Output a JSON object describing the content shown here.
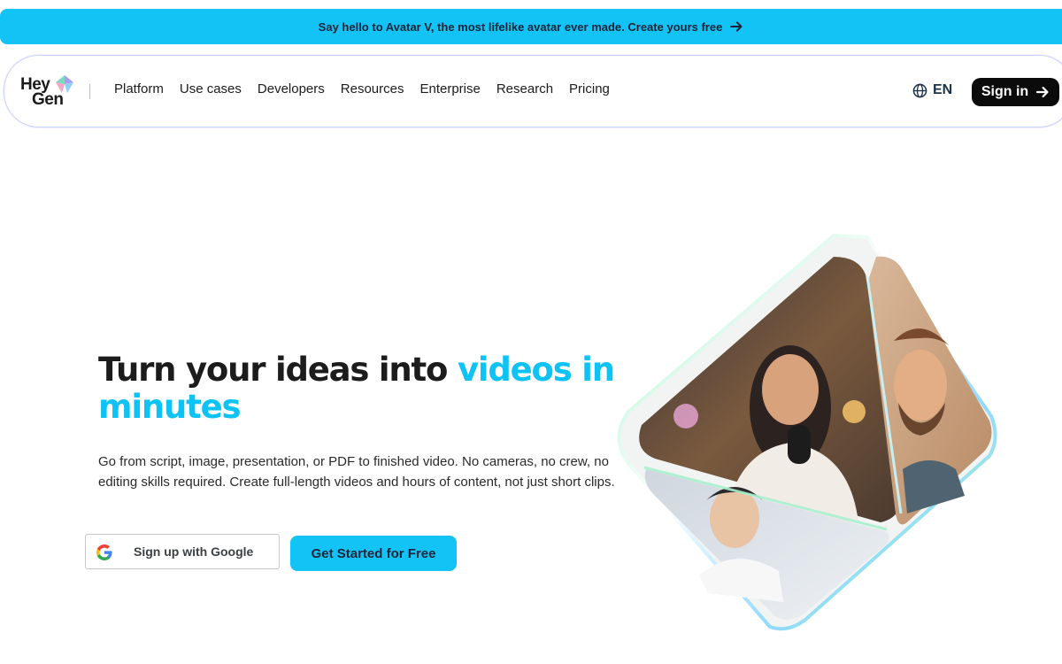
{
  "announcement": {
    "text": "Say hello to Avatar V, the most lifelike avatar ever made. Create yours free",
    "icon": "arrow-right-icon"
  },
  "header": {
    "logo_line1": "Hey",
    "logo_line2": "Gen",
    "nav": [
      {
        "label": "Platform"
      },
      {
        "label": "Use cases"
      },
      {
        "label": "Developers"
      },
      {
        "label": "Resources"
      },
      {
        "label": "Enterprise"
      },
      {
        "label": "Research"
      },
      {
        "label": "Pricing"
      }
    ],
    "language": {
      "label": "EN",
      "icon": "globe-icon"
    },
    "signin": {
      "label": "Sign in",
      "icon": "arrow-right-icon"
    }
  },
  "hero": {
    "title_plain": "Turn your ideas into ",
    "title_accent_1": "videos in",
    "title_accent_2": "minutes",
    "subtitle": "Go from script, image, presentation, or PDF to finished video. No cameras, no crew, no editing skills required. Create full-length videos and hours of content, not just short clips.",
    "google_button": "Sign up with Google",
    "cta_button": "Get Started for Free"
  },
  "colors": {
    "accent": "#14c3f5",
    "dark": "#0b0b0b",
    "text": "#1c1c1c"
  }
}
